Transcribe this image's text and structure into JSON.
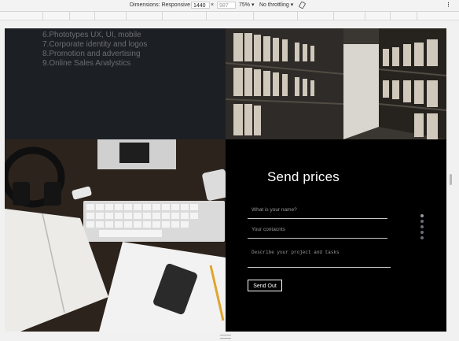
{
  "devtools": {
    "dimensions_label": "Dimensions: Responsive",
    "width_value": "1440",
    "times": "×",
    "height_value": "987",
    "zoom": "75%",
    "throttling": "No throttling"
  },
  "services": {
    "items": [
      "6.Phototypes UX, UI, mobile",
      "7.Corporate identity and logos",
      "8.Promotion and advertising",
      "9.Online Sales Analystics"
    ]
  },
  "contact_form": {
    "title": "Send prices",
    "name_placeholder": "What is your name?",
    "contacts_placeholder": "Your contacnts",
    "project_placeholder": "Describe your project and tasks",
    "send_label": "Send Out"
  },
  "slider": {
    "dot_count": 5
  },
  "colors": {
    "page_bg": "#000000",
    "dark_tile": "#1c1f24",
    "text_muted": "#6b6e72",
    "white": "#ffffff"
  }
}
